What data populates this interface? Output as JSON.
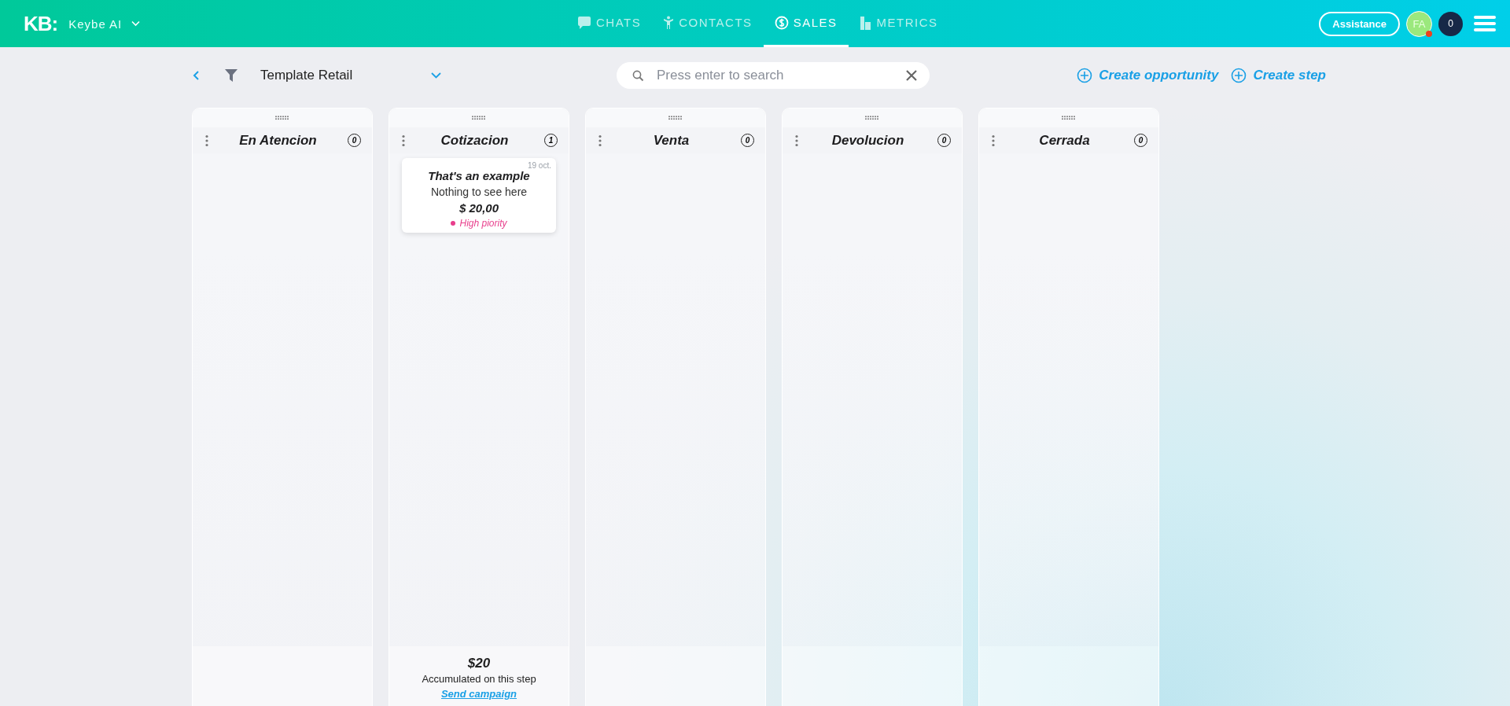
{
  "header": {
    "logo": "KB:",
    "workspace": "Keybe AI",
    "nav": [
      {
        "label": "CHATS",
        "selected": false
      },
      {
        "label": "CONTACTS",
        "selected": false
      },
      {
        "label": "SALES",
        "selected": true
      },
      {
        "label": "METRICS",
        "selected": false
      }
    ],
    "assistance_button": "Assistance",
    "avatar": "FA",
    "notifications": "0"
  },
  "toolbar": {
    "pipeline": "Template Retail",
    "search": {
      "placeholder": "Press enter to search"
    },
    "actions": [
      "Create opportunity",
      "Create step"
    ]
  },
  "columns": [
    {
      "title": "En Atencion",
      "count": "0"
    },
    {
      "title": "Cotizacion",
      "count": "1",
      "cards": [
        {
          "date": "19 oct.",
          "title": "That's an example",
          "subtitle": "Nothing to see here",
          "amount": "$ 20,00",
          "priority": "High piority",
          "color": "#e83e8c"
        }
      ],
      "footer": {
        "total": "$20",
        "caption": "Accumulated on this step",
        "link": "Send campaign"
      }
    },
    {
      "title": "Venta",
      "count": "0"
    },
    {
      "title": "Devolucion",
      "count": "0"
    },
    {
      "title": "Cerrada",
      "count": "0"
    }
  ]
}
